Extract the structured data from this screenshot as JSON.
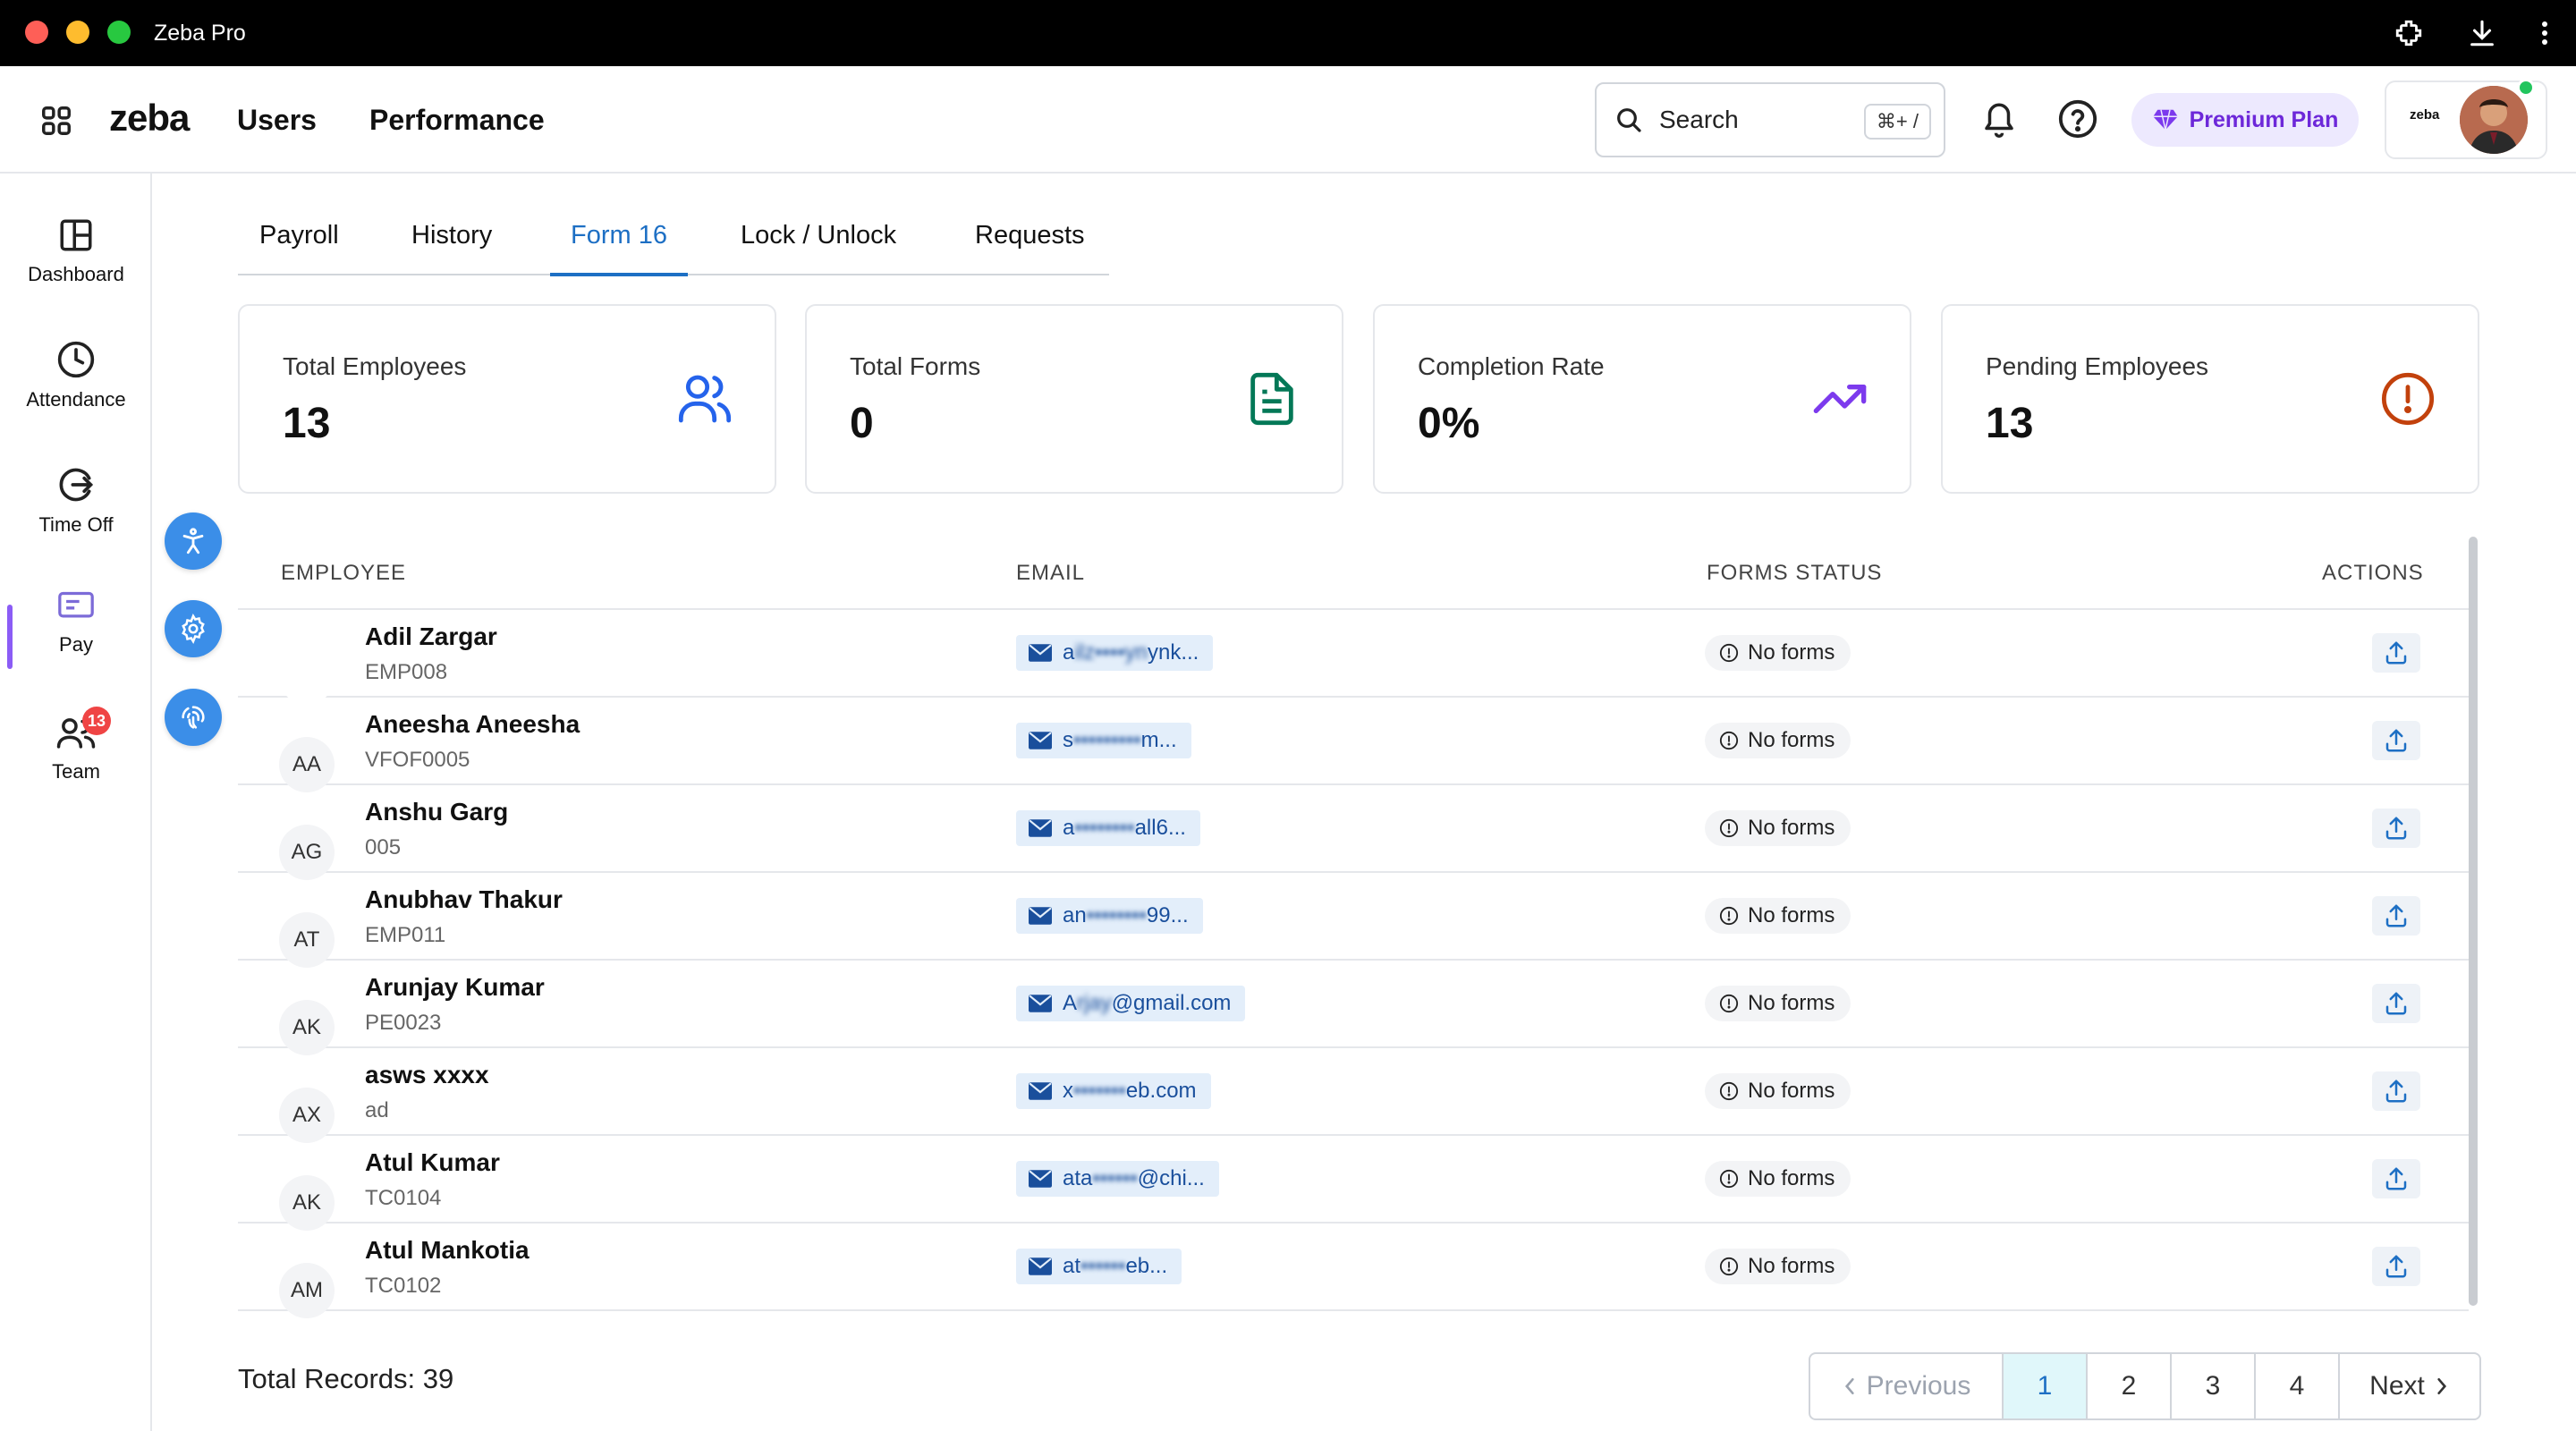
{
  "window": {
    "title": "Zeba Pro"
  },
  "header": {
    "logo": "zeba",
    "nav": [
      "Users",
      "Performance"
    ],
    "search": {
      "placeholder": "Search",
      "shortcut": "⌘+ /"
    },
    "premium_label": "Premium Plan",
    "profile_logo": "zeba"
  },
  "sidebar": {
    "items": [
      {
        "label": "Dashboard",
        "icon": "dashboard-icon"
      },
      {
        "label": "Attendance",
        "icon": "clock-icon"
      },
      {
        "label": "Time Off",
        "icon": "time-off-icon"
      },
      {
        "label": "Pay",
        "icon": "pay-card-icon",
        "active": true
      },
      {
        "label": "Team",
        "icon": "team-icon",
        "badge": "13"
      }
    ]
  },
  "tabs": [
    "Payroll",
    "History",
    "Form 16",
    "Lock / Unlock",
    "Requests"
  ],
  "active_tab": "Form 16",
  "stats": [
    {
      "label": "Total Employees",
      "value": "13",
      "icon": "users-icon",
      "color": "#2563eb"
    },
    {
      "label": "Total Forms",
      "value": "0",
      "icon": "document-icon",
      "color": "#047857"
    },
    {
      "label": "Completion Rate",
      "value": "0%",
      "icon": "trending-up-icon",
      "color": "#7c3aed"
    },
    {
      "label": "Pending Employees",
      "value": "13",
      "icon": "alert-circle-icon",
      "color": "#c2410c"
    }
  ],
  "table": {
    "headers": [
      "EMPLOYEE",
      "EMAIL",
      "FORMS STATUS",
      "ACTIONS"
    ],
    "rows": [
      {
        "initials": "",
        "name": "Adil Zargar",
        "id": "EMP008",
        "email_start": "a",
        "email_mask": "ilz••••yn",
        "email_end": "ynk...",
        "status": "No forms"
      },
      {
        "initials": "AA",
        "name": "Aneesha Aneesha",
        "id": "VFOF0005",
        "email_start": "s",
        "email_mask": "•••••••••",
        "email_end": "m...",
        "status": "No forms"
      },
      {
        "initials": "AG",
        "name": "Anshu Garg",
        "id": "005",
        "email_start": "a",
        "email_mask": "••••••••",
        "email_end": "all6...",
        "status": "No forms"
      },
      {
        "initials": "AT",
        "name": "Anubhav Thakur",
        "id": "EMP011",
        "email_start": "an",
        "email_mask": "••••••••",
        "email_end": "99...",
        "status": "No forms"
      },
      {
        "initials": "AK",
        "name": "Arunjay Kumar",
        "id": "PE0023",
        "email_start": "A",
        "email_mask": "rjay",
        "email_end": "@gmail.com",
        "status": "No forms"
      },
      {
        "initials": "AX",
        "name": "asws xxxx",
        "id": "ad",
        "email_start": "x",
        "email_mask": "•••••••",
        "email_end": "eb.com",
        "status": "No forms"
      },
      {
        "initials": "AK",
        "name": "Atul Kumar",
        "id": "TC0104",
        "email_start": "ata",
        "email_mask": "••••••",
        "email_end": "@chi...",
        "status": "No forms"
      },
      {
        "initials": "AM",
        "name": "Atul Mankotia",
        "id": "TC0102",
        "email_start": "at",
        "email_mask": "••••••",
        "email_end": "eb...",
        "status": "No forms"
      }
    ]
  },
  "footer": {
    "total_records": "Total Records: 39",
    "pagination": {
      "previous": "Previous",
      "pages": [
        "1",
        "2",
        "3",
        "4"
      ],
      "active_page": "1",
      "next": "Next"
    }
  }
}
